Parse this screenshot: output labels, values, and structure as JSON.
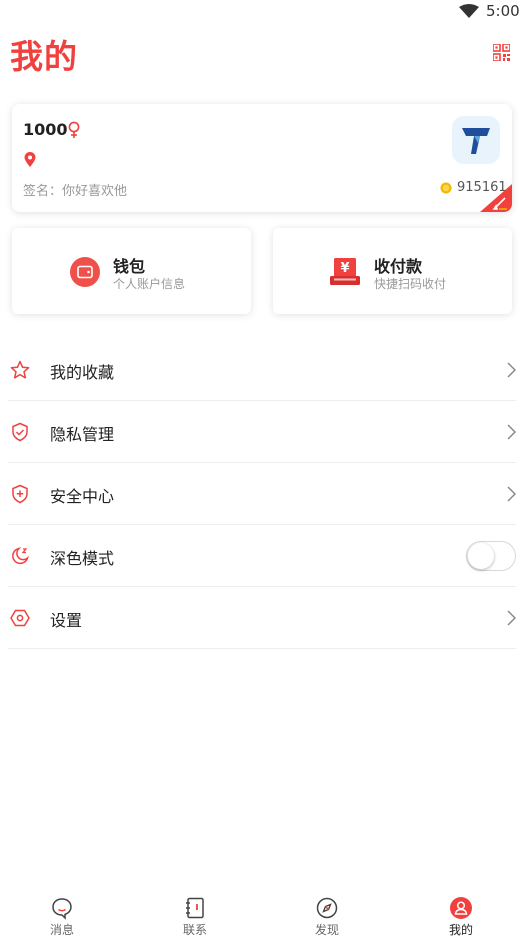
{
  "status_bar": {
    "time": "5:00"
  },
  "header": {
    "title": "我的"
  },
  "profile": {
    "username": "1000",
    "signature": "签名：你好喜欢他",
    "coins": "915161"
  },
  "quick_actions": [
    {
      "title": "钱包",
      "subtitle": "个人账户信息"
    },
    {
      "title": "收付款",
      "subtitle": "快捷扫码收付"
    }
  ],
  "menu": [
    {
      "label": "我的收藏",
      "icon": "star-icon"
    },
    {
      "label": "隐私管理",
      "icon": "shield-check-icon"
    },
    {
      "label": "安全中心",
      "icon": "shield-plus-icon"
    },
    {
      "label": "深色模式",
      "icon": "moon-icon",
      "toggle": false
    },
    {
      "label": "设置",
      "icon": "gear-icon"
    }
  ],
  "bottom_nav": [
    {
      "label": "消息",
      "icon": "chat-bubble-icon"
    },
    {
      "label": "联系",
      "icon": "contacts-book-icon"
    },
    {
      "label": "发现",
      "icon": "compass-icon"
    },
    {
      "label": "我的",
      "icon": "profile-icon",
      "active": true
    }
  ],
  "colors": {
    "accent": "#f0413f",
    "logo_blue": "#1f4e9a",
    "coin": "#f5b800"
  }
}
